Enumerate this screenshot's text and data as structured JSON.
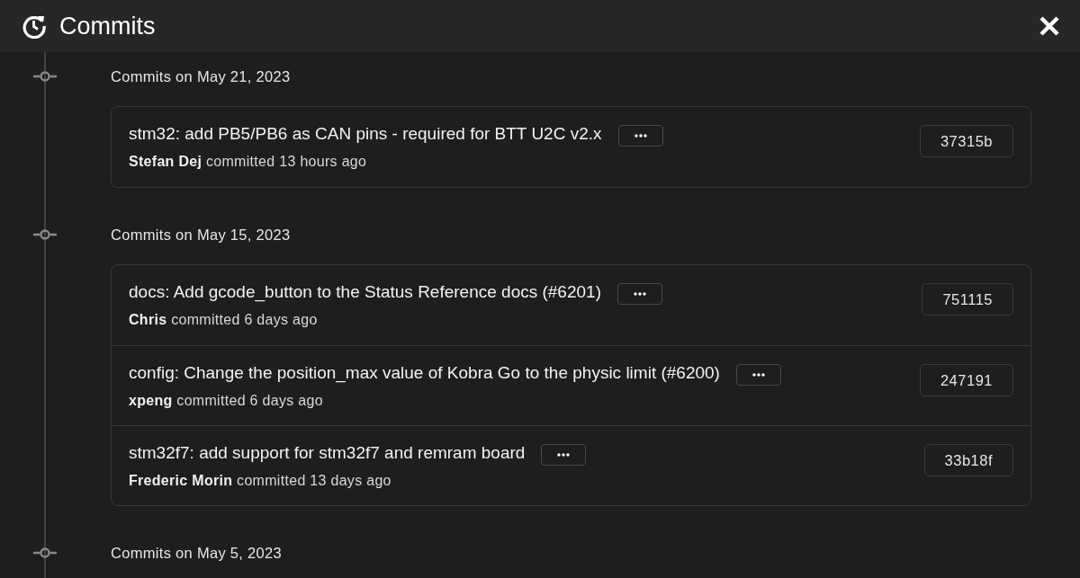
{
  "window": {
    "title": "Commits"
  },
  "groups": [
    {
      "heading": "Commits on May 21, 2023",
      "commits": [
        {
          "title": "stm32: add PB5/PB6 as CAN pins - required for BTT U2C v2.x",
          "meta": "**Stefan Dej** committed 13 hours ago",
          "hash": "37315b"
        }
      ]
    },
    {
      "heading": "Commits on May 15, 2023",
      "commits": [
        {
          "title": "docs: Add gcode_button to the Status Reference docs (#6201)",
          "meta": "**Chris** committed 6 days ago",
          "hash": "751115"
        },
        {
          "title": "config: Change the position_max value of Kobra Go to the physic limit (#6200)",
          "meta": "**xpeng** committed 6 days ago",
          "hash": "247191"
        },
        {
          "title": "stm32f7: add support for stm32f7 and remram board",
          "meta": "**Frederic Morin** committed 13 days ago",
          "hash": "33b18f"
        }
      ]
    },
    {
      "heading": "Commits on May 5, 2023"
    }
  ]
}
